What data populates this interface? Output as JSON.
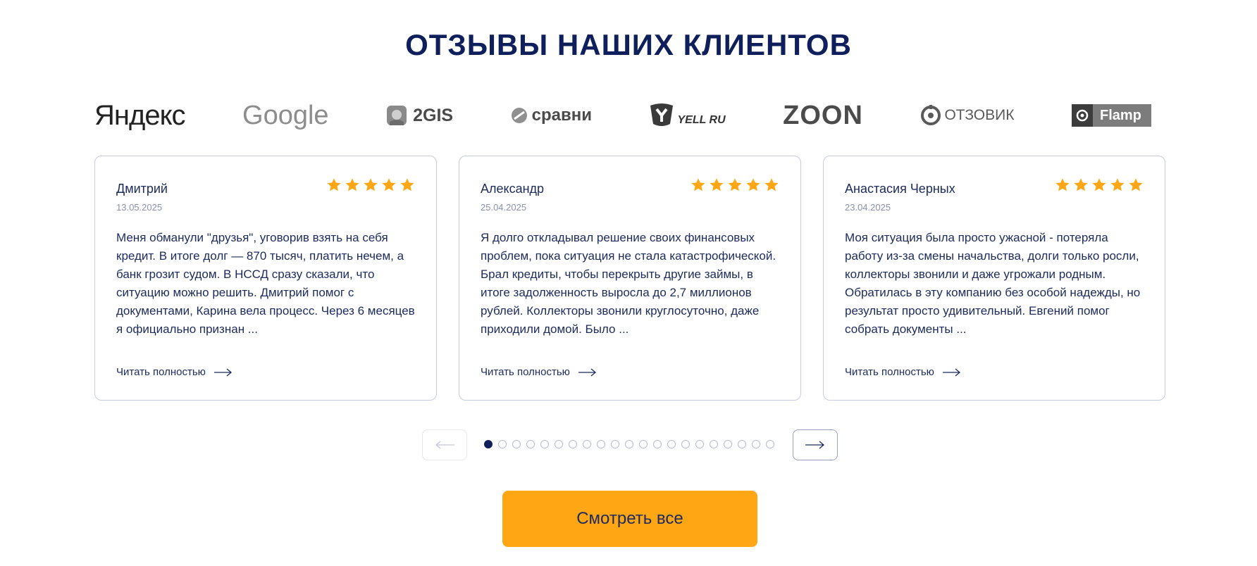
{
  "section": {
    "title": "ОТЗЫВЫ НАШИХ КЛИЕНТОВ"
  },
  "logos": [
    {
      "name": "yandex",
      "text": "Яндекс",
      "icon": "yandex-logo"
    },
    {
      "name": "google",
      "text": "Google",
      "icon": "google-logo"
    },
    {
      "name": "2gis",
      "text": "2GIS",
      "icon": "2gis-logo"
    },
    {
      "name": "sravni",
      "text": "сравни",
      "icon": "sravni-logo"
    },
    {
      "name": "yell",
      "text": "YELL RU",
      "icon": "yell-logo"
    },
    {
      "name": "zoon",
      "text": "ZOON",
      "icon": "zoon-logo"
    },
    {
      "name": "otzovik",
      "text": "ОТЗОВИК",
      "icon": "otzovik-logo"
    },
    {
      "name": "flamp",
      "text": "Flamp",
      "icon": "flamp-logo"
    }
  ],
  "reviews": [
    {
      "name": "Дмитрий",
      "date": "13.05.2025",
      "rating": 5,
      "text": "Меня обманули \"друзья\", уговорив взять на себя кредит. В итоге долг — 870 тысяч, платить нечем, а банк грозит судом. В НССД сразу сказали, что ситуацию можно решить. Дмитрий помог с документами, Карина вела процесс. Через 6 месяцев я официально признан ...",
      "read_more": "Читать полностью"
    },
    {
      "name": "Александр",
      "date": "25.04.2025",
      "rating": 5,
      "text": "Я долго откладывал решение своих финансовых проблем, пока ситуация не стала катастрофической. Брал кредиты, чтобы перекрыть другие займы, в итоге задолженность выросла до 2,7 миллионов рублей. Коллекторы звонили круглосуточно, даже приходили домой. Было ...",
      "read_more": "Читать полностью"
    },
    {
      "name": "Анастасия Черных",
      "date": "23.04.2025",
      "rating": 5,
      "text": "Моя ситуация была просто ужасной - потеряла работу из-за смены начальства, долги только росли, коллекторы звонили и даже угрожали родным. Обратилась в эту компанию без особой надежды, но результат просто удивительный. Евгений помог собрать документы ...",
      "read_more": "Читать полностью"
    }
  ],
  "pagination": {
    "total": 21,
    "active": 1
  },
  "colors": {
    "accent": "#ffa614",
    "navy": "#0f1f5c",
    "star": "#ffa614",
    "border": "#c7cbe0"
  },
  "cta": {
    "label": "Смотреть все"
  }
}
